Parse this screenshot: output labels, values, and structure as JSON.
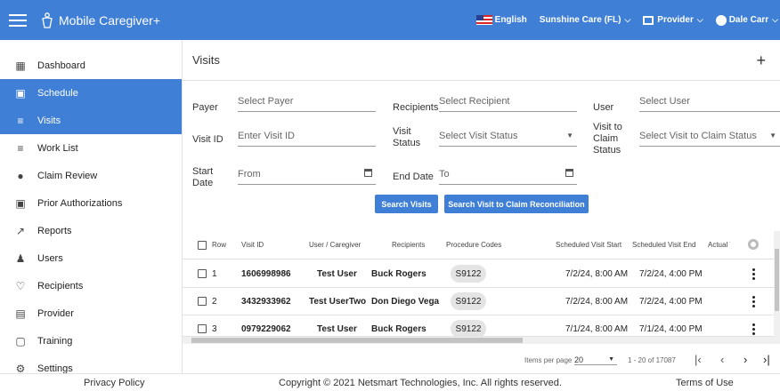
{
  "app": {
    "title": "Mobile Caregiver+"
  },
  "topbar": {
    "language": "English",
    "agency": "Sunshine Care (FL)",
    "role": "Provider",
    "user": "Dale Carr"
  },
  "sidebar": {
    "items": [
      {
        "label": "Dashboard",
        "icon": "dashboard-icon"
      },
      {
        "label": "Schedule",
        "icon": "calendar-icon"
      },
      {
        "label": "Visits",
        "icon": "filter-icon"
      },
      {
        "label": "Work List",
        "icon": "list-icon"
      },
      {
        "label": "Claim Review",
        "icon": "alert-icon"
      },
      {
        "label": "Prior Authorizations",
        "icon": "calendar-check-icon"
      },
      {
        "label": "Reports",
        "icon": "trend-icon"
      },
      {
        "label": "Users",
        "icon": "users-icon"
      },
      {
        "label": "Recipients",
        "icon": "recipients-icon"
      },
      {
        "label": "Provider",
        "icon": "provider-icon"
      },
      {
        "label": "Training",
        "icon": "training-icon"
      },
      {
        "label": "Settings",
        "icon": "gear-icon"
      }
    ],
    "active": [
      "Schedule",
      "Visits"
    ]
  },
  "page": {
    "title": "Visits",
    "add": "+"
  },
  "filters": {
    "payer_label": "Payer",
    "payer_placeholder": "Select Payer",
    "recipients_label": "Recipients",
    "recipients_placeholder": "Select Recipient",
    "user_label": "User",
    "user_placeholder": "Select User",
    "visit_id_label": "Visit ID",
    "visit_id_placeholder": "Enter Visit ID",
    "visit_status_label_1": "Visit",
    "visit_status_label_2": "Status",
    "visit_status_placeholder": "Select Visit Status",
    "claim_status_label_1": "Visit to",
    "claim_status_label_2": "Claim",
    "claim_status_label_3": "Status",
    "claim_status_placeholder": "Select Visit to Claim Status",
    "start_date_label_1": "Start",
    "start_date_label_2": "Date",
    "start_date_placeholder": "From",
    "end_date_label": "End Date",
    "end_date_placeholder": "To"
  },
  "buttons": {
    "search_visits": "Search Visits",
    "search_reconciliation": "Search Visit to Claim Reconciliation"
  },
  "table": {
    "headers": [
      "Row",
      "Visit ID",
      "User / Caregiver",
      "Recipients",
      "Procedure Codes",
      "Scheduled Visit Start",
      "Scheduled Visit End",
      "Actual V"
    ],
    "rows": [
      {
        "row": "1",
        "visit_id": "1606998986",
        "user": "Test User",
        "recipient": "Buck Rogers",
        "code": "S9122",
        "start": "7/2/24, 8:00 AM",
        "end": "7/2/24, 4:00 PM"
      },
      {
        "row": "2",
        "visit_id": "3432933962",
        "user": "Test UserTwo",
        "recipient": "Don Diego Vega",
        "code": "S9122",
        "start": "7/2/24, 8:00 AM",
        "end": "7/2/24, 4:00 PM"
      },
      {
        "row": "3",
        "visit_id": "0979229062",
        "user": "Test User",
        "recipient": "Buck Rogers",
        "code": "S9122",
        "start": "7/1/24, 8:00 AM",
        "end": "7/1/24, 4:00 PM"
      }
    ]
  },
  "pagination": {
    "items_per_page_label": "Items per page",
    "items_per_page": "20",
    "range": "1 - 20 of 17087"
  },
  "footer": {
    "privacy": "Privacy Policy",
    "copyright": "Copyright © 2021 Netsmart Technologies, Inc. All rights reserved.",
    "terms": "Terms of Use"
  }
}
